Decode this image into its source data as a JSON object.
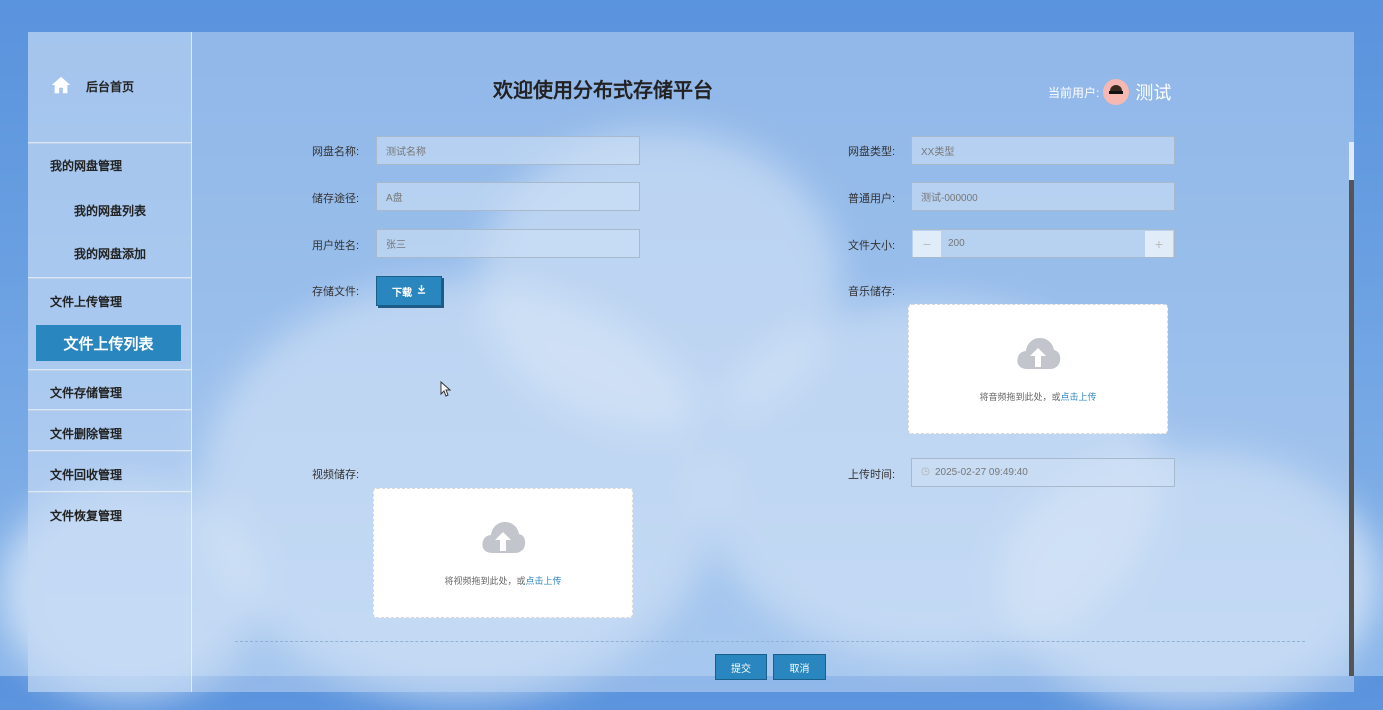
{
  "sidebar": {
    "home": "后台首页",
    "items": [
      {
        "label": "我的网盘管理"
      },
      {
        "label": "我的网盘列表"
      },
      {
        "label": "我的网盘添加"
      },
      {
        "label": "文件上传管理"
      },
      {
        "label": "文件上传列表"
      },
      {
        "label": "文件存储管理"
      },
      {
        "label": "文件删除管理"
      },
      {
        "label": "文件回收管理"
      },
      {
        "label": "文件恢复管理"
      }
    ]
  },
  "header": {
    "title": "欢迎使用分布式存储平台",
    "user_label": "当前用户:",
    "user_name": "测试"
  },
  "form": {
    "disk_name": {
      "label": "网盘名称:",
      "value": "测试名称"
    },
    "disk_type": {
      "label": "网盘类型:",
      "value": "XX类型"
    },
    "path": {
      "label": "储存途径:",
      "value": "A盘"
    },
    "normal_user": {
      "label": "普通用户:",
      "value": "测试-000000"
    },
    "user_name": {
      "label": "用户姓名:",
      "value": "张三"
    },
    "file_size": {
      "label": "文件大小:",
      "value": "200",
      "minus": "−",
      "plus": "+"
    },
    "storage_file": {
      "label": "存储文件:",
      "button": "下载"
    },
    "music": {
      "label": "音乐储存:",
      "hint": "将音频拖到此处，或",
      "link": "点击上传"
    },
    "video": {
      "label": "视频储存:",
      "hint": "将视频拖到此处，或",
      "link": "点击上传"
    },
    "upload_time": {
      "label": "上传时间:",
      "value": "2025-02-27 09:49:40"
    }
  },
  "actions": {
    "submit": "提交",
    "cancel": "取消"
  },
  "colors": {
    "accent": "#2a86bf",
    "active_menu": "#2a86bf"
  },
  "icons": [
    "home-icon",
    "download-icon",
    "cloud-upload-icon",
    "clock-icon",
    "avatar"
  ]
}
